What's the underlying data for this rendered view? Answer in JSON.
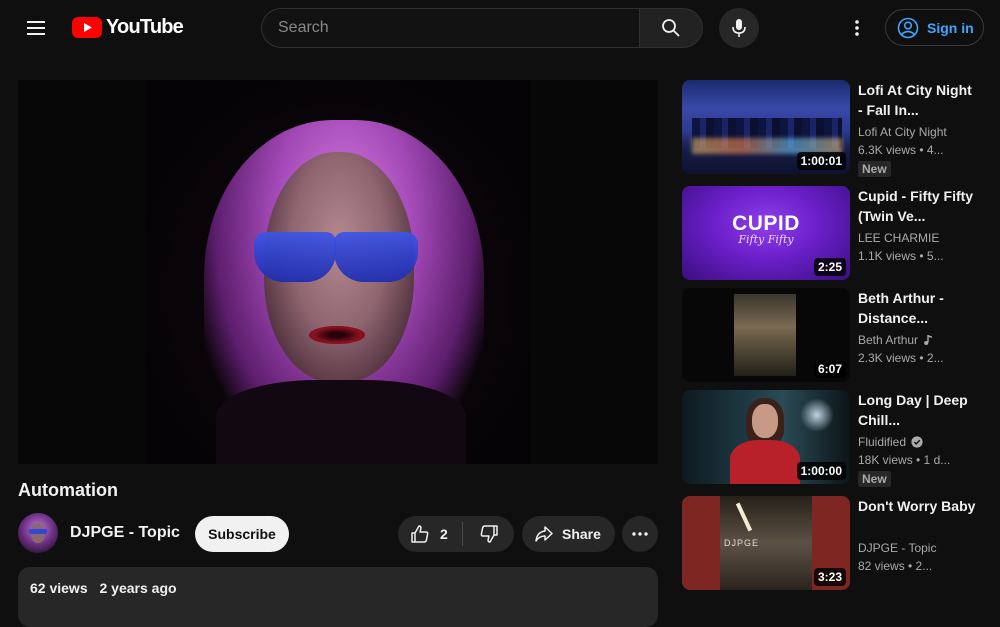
{
  "header": {
    "logo_text": "YouTube",
    "search_placeholder": "Search",
    "sign_in_label": "Sign in"
  },
  "video": {
    "title": "Automation",
    "channel": "DJPGE - Topic",
    "subscribe_label": "Subscribe",
    "like_count": "2",
    "share_label": "Share",
    "views": "62 views",
    "age": "2 years ago"
  },
  "recommendations": [
    {
      "title": "Lofi At City Night - Fall In...",
      "channel": "Lofi At City Night",
      "meta": "6.3K views • 4...",
      "duration": "1:00:01",
      "badge": "New",
      "verified": false,
      "music": false
    },
    {
      "title": "Cupid - Fifty Fifty (Twin Ve...",
      "channel": "LEE CHARMIE",
      "meta": "1.1K views • 5...",
      "duration": "2:25",
      "badge": "",
      "verified": false,
      "music": false,
      "thumb_text": "CUPID",
      "thumb_subtext": "Fifty Fifty"
    },
    {
      "title": "Beth Arthur - Distance...",
      "channel": "Beth Arthur",
      "meta": "2.3K views • 2...",
      "duration": "6:07",
      "badge": "",
      "verified": false,
      "music": true
    },
    {
      "title": "Long Day | Deep Chill...",
      "channel": "Fluidified",
      "meta": "18K views • 1 d...",
      "duration": "1:00:00",
      "badge": "New",
      "verified": true,
      "music": false
    },
    {
      "title": "Don't Worry Baby",
      "channel": "DJPGE - Topic",
      "meta": "82 views • 2...",
      "duration": "3:23",
      "badge": "",
      "verified": false,
      "music": false,
      "thumb_text": "DJPGE"
    }
  ],
  "colors": {
    "background": "#0f0f0f",
    "brand_red": "#ff0000",
    "link_blue": "#3ea6ff",
    "chip": "#272727"
  }
}
